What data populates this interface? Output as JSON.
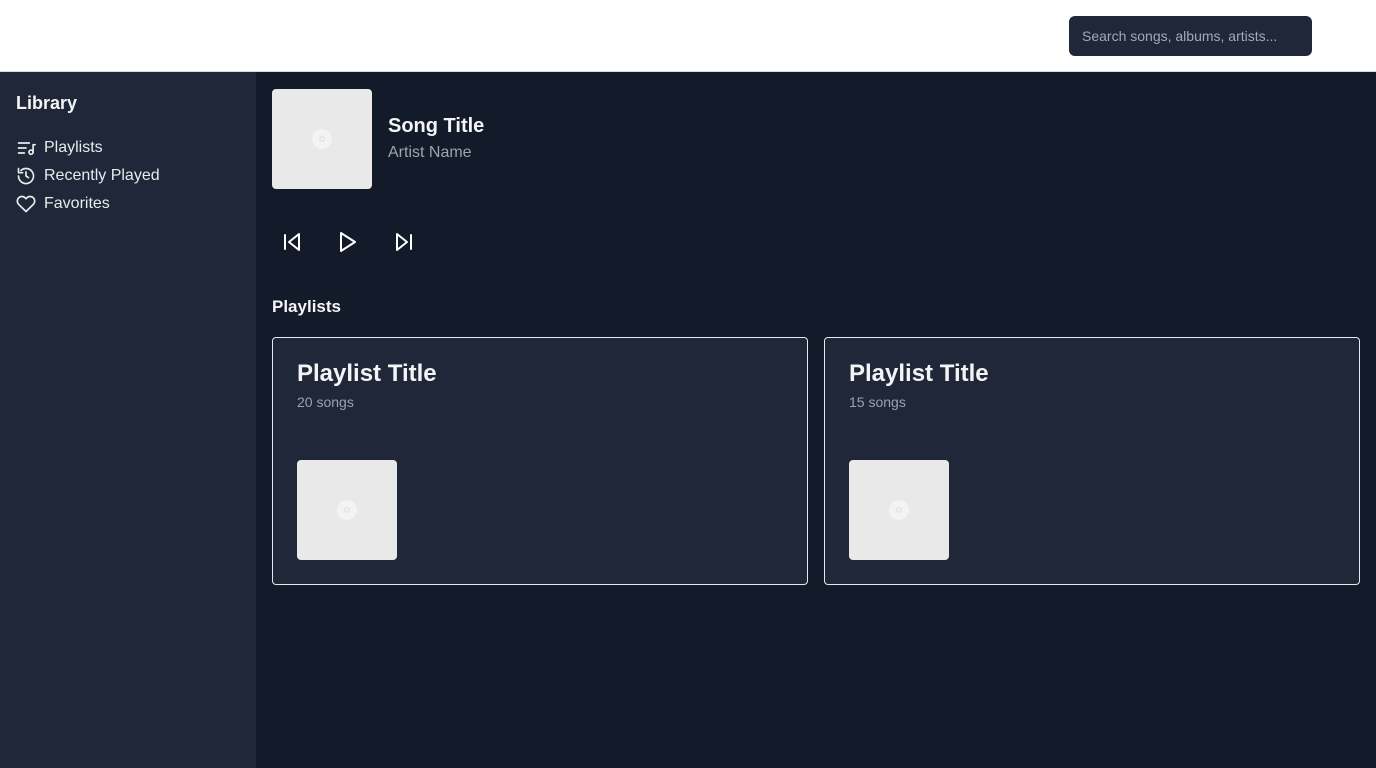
{
  "search": {
    "placeholder": "Search songs, albums, artists..."
  },
  "sidebar": {
    "title": "Library",
    "items": [
      {
        "label": "Playlists",
        "icon": "playlist-icon"
      },
      {
        "label": "Recently Played",
        "icon": "history-icon"
      },
      {
        "label": "Favorites",
        "icon": "heart-icon"
      }
    ]
  },
  "now_playing": {
    "title": "Song Title",
    "artist": "Artist Name"
  },
  "controls": {
    "icons": [
      "skip-back-icon",
      "play-icon",
      "skip-forward-icon"
    ]
  },
  "playlists_section": {
    "title": "Playlists",
    "cards": [
      {
        "title": "Playlist Title",
        "count": "20 songs"
      },
      {
        "title": "Playlist Title",
        "count": "15 songs"
      }
    ]
  },
  "colors": {
    "background": "#131a29",
    "sidebar": "#1f2738",
    "topbar": "#ffffff",
    "card_border": "#e5e7eb",
    "muted_text": "#9ca3af",
    "placeholder_art": "#e9e9e9"
  }
}
